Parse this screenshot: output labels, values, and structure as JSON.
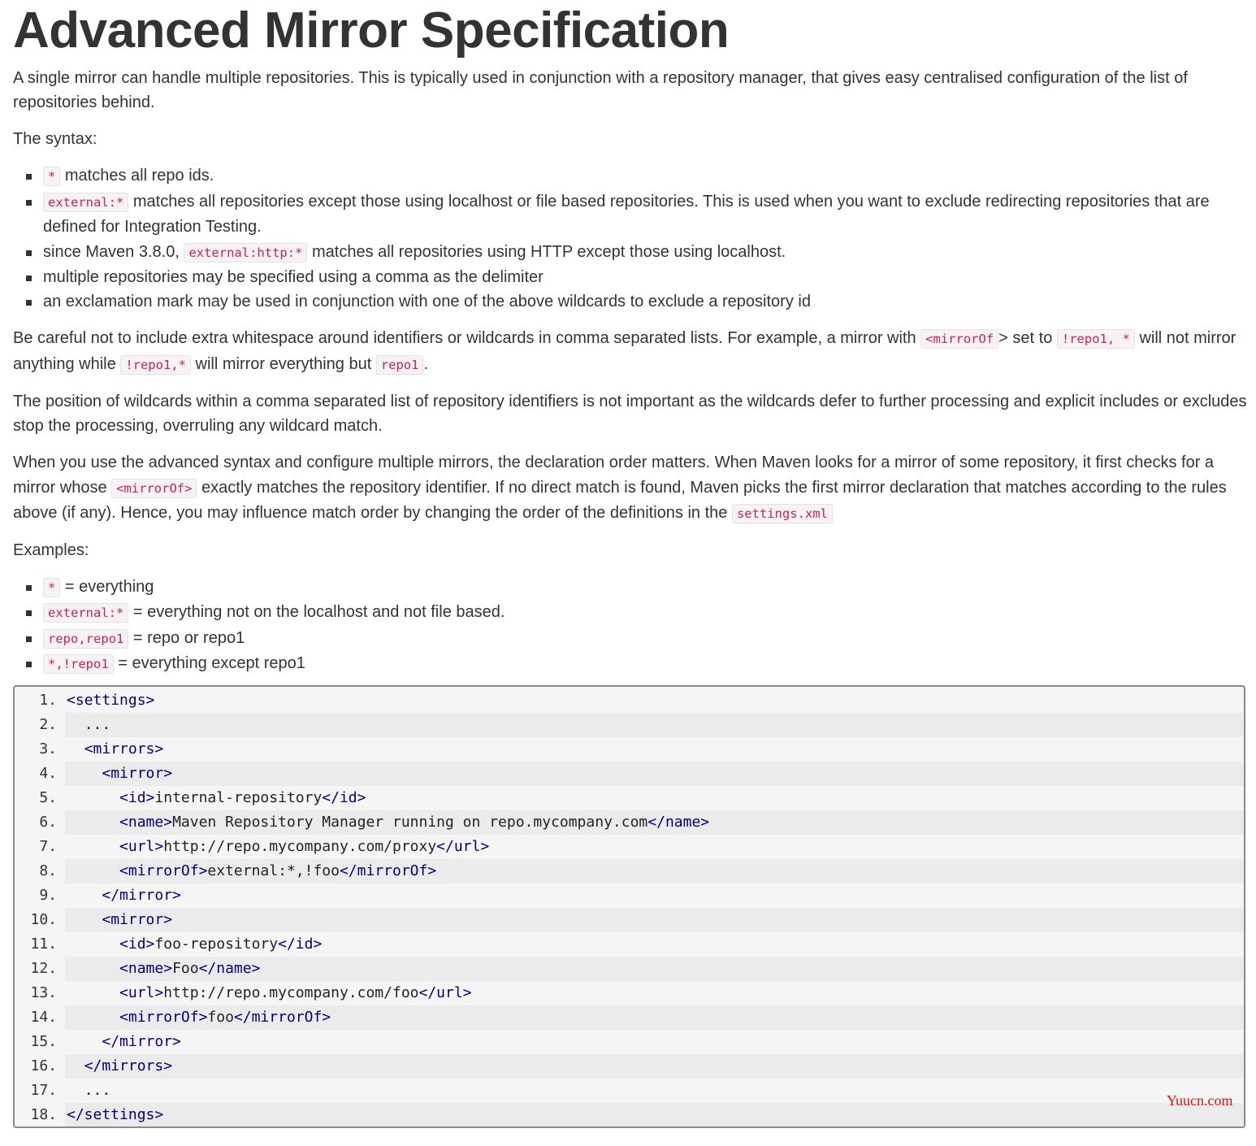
{
  "title": "Advanced Mirror Specification",
  "intro": "A single mirror can handle multiple repositories. This is typically used in conjunction with a repository manager, that gives easy centralised configuration of the list of repositories behind.",
  "syntax_label": "The syntax:",
  "syntax_items": [
    {
      "code": "*",
      "text": " matches all repo ids."
    },
    {
      "code": "external:*",
      "text": " matches all repositories except those using localhost or file based repositories. This is used when you want to exclude redirecting repositories that are defined for Integration Testing."
    },
    {
      "prefix": "since Maven 3.8.0, ",
      "code": "external:http:*",
      "text": " matches all repositories using HTTP except those using localhost."
    },
    {
      "text": "multiple repositories may be specified using a comma as the delimiter"
    },
    {
      "text": "an exclamation mark may be used in conjunction with one of the above wildcards to exclude a repository id"
    }
  ],
  "careful": {
    "t1": "Be careful not to include extra whitespace around identifiers or wildcards in comma separated lists. For example, a mirror with ",
    "c1": "<mirrorOf",
    "t2": "> set to ",
    "c2": "!repo1, *",
    "t3": " will not mirror anything while ",
    "c3": "!repo1,*",
    "t4": " will mirror everything but ",
    "c4": "repo1",
    "t5": "."
  },
  "position_para": "The position of wildcards within a comma separated list of repository identifiers is not important as the wildcards defer to further processing and explicit includes or excludes stop the processing, overruling any wildcard match.",
  "order": {
    "t1": "When you use the advanced syntax and configure multiple mirrors, the declaration order matters. When Maven looks for a mirror of some repository, it first checks for a mirror whose ",
    "c1": "<mirrorOf>",
    "t2": " exactly matches the repository identifier. If no direct match is found, Maven picks the first mirror declaration that matches according to the rules above (if any). Hence, you may influence match order by changing the order of the definitions in the ",
    "c2": "settings.xml"
  },
  "examples_label": "Examples:",
  "examples": [
    {
      "code": "*",
      "text": " = everything"
    },
    {
      "code": "external:*",
      "text": " = everything not on the localhost and not file based."
    },
    {
      "code": "repo,repo1",
      "text": " = repo or repo1"
    },
    {
      "code": "*,!repo1",
      "text": " = everything except repo1"
    }
  ],
  "code_lines": [
    {
      "num": "1.",
      "indent": "",
      "open": "<settings>",
      "text": "",
      "close": ""
    },
    {
      "num": "2.",
      "indent": "  ",
      "open": "",
      "text": "...",
      "close": ""
    },
    {
      "num": "3.",
      "indent": "  ",
      "open": "<mirrors>",
      "text": "",
      "close": ""
    },
    {
      "num": "4.",
      "indent": "    ",
      "open": "<mirror>",
      "text": "",
      "close": ""
    },
    {
      "num": "5.",
      "indent": "      ",
      "open": "<id>",
      "text": "internal-repository",
      "close": "</id>"
    },
    {
      "num": "6.",
      "indent": "      ",
      "open": "<name>",
      "text": "Maven Repository Manager running on repo.mycompany.com",
      "close": "</name>"
    },
    {
      "num": "7.",
      "indent": "      ",
      "open": "<url>",
      "text": "http://repo.mycompany.com/proxy",
      "close": "</url>"
    },
    {
      "num": "8.",
      "indent": "      ",
      "open": "<mirrorOf>",
      "text": "external:*,!foo",
      "close": "</mirrorOf>"
    },
    {
      "num": "9.",
      "indent": "    ",
      "open": "</mirror>",
      "text": "",
      "close": ""
    },
    {
      "num": "10.",
      "indent": "    ",
      "open": "<mirror>",
      "text": "",
      "close": ""
    },
    {
      "num": "11.",
      "indent": "      ",
      "open": "<id>",
      "text": "foo-repository",
      "close": "</id>"
    },
    {
      "num": "12.",
      "indent": "      ",
      "open": "<name>",
      "text": "Foo",
      "close": "</name>"
    },
    {
      "num": "13.",
      "indent": "      ",
      "open": "<url>",
      "text": "http://repo.mycompany.com/foo",
      "close": "</url>"
    },
    {
      "num": "14.",
      "indent": "      ",
      "open": "<mirrorOf>",
      "text": "foo",
      "close": "</mirrorOf>"
    },
    {
      "num": "15.",
      "indent": "    ",
      "open": "</mirror>",
      "text": "",
      "close": ""
    },
    {
      "num": "16.",
      "indent": "  ",
      "open": "</mirrors>",
      "text": "",
      "close": ""
    },
    {
      "num": "17.",
      "indent": "  ",
      "open": "",
      "text": "...",
      "close": ""
    },
    {
      "num": "18.",
      "indent": "",
      "open": "</settings>",
      "text": "",
      "close": ""
    }
  ],
  "watermark": "Yuucn.com",
  "colors": {
    "text": "#333333",
    "code_fg": "#c7254e",
    "code_bg": "#f9f2f4",
    "xml_tag": "#000080",
    "watermark": "#dd1111"
  }
}
